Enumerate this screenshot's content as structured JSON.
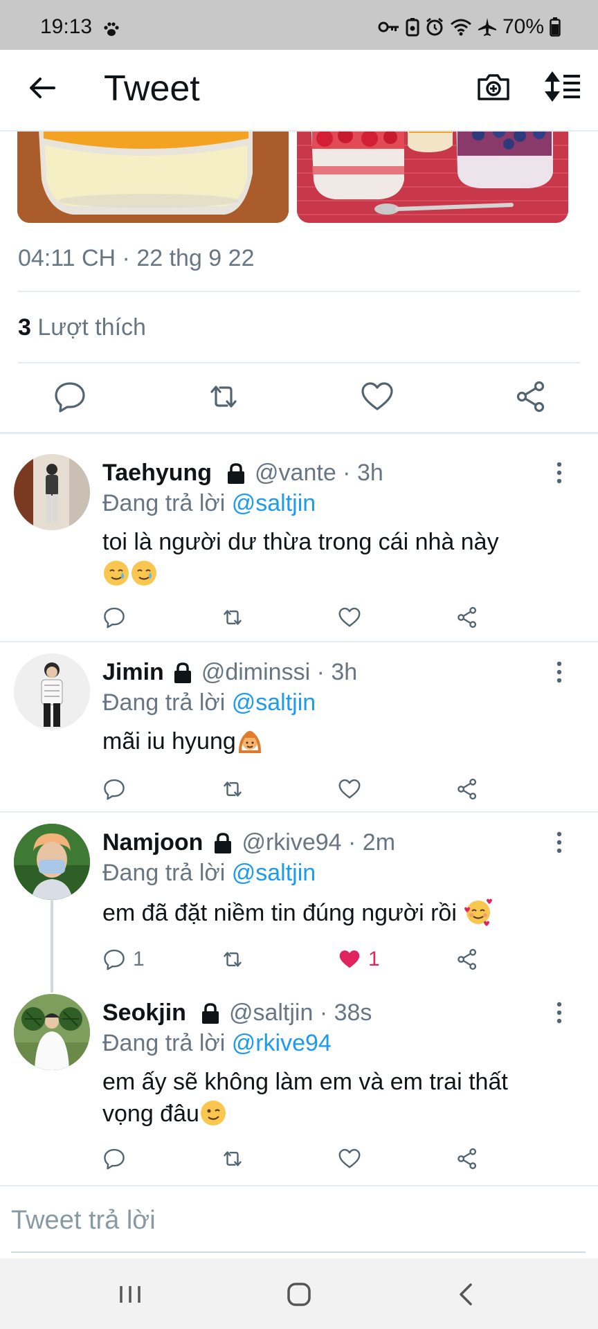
{
  "status_bar": {
    "time": "19:13",
    "battery": "70%",
    "icons": [
      "paw-icon",
      "key-icon",
      "battery-saver-icon",
      "alarm-icon",
      "wifi-icon",
      "airplane-icon",
      "battery-icon"
    ]
  },
  "header": {
    "title": "Tweet",
    "icons": [
      "back-arrow-icon",
      "camera-icon",
      "sort-icon"
    ]
  },
  "tweet": {
    "timestamp": "04:11 CH · 22 thg 9 22",
    "likes_count": "3",
    "likes_label": "Lượt thích"
  },
  "replies": [
    {
      "name": "Taehyung",
      "meta": "@vante · 3h",
      "replying_prefix": "Đang trả lời",
      "replying_to": "@saltjin",
      "text": "toi là người dư thừa trong cái nhà này",
      "emoji": [
        "smiling-face-with-tear-icon",
        "smiling-face-with-tear-icon"
      ],
      "reply_count": "",
      "like_count": "",
      "liked": false
    },
    {
      "name": "Jimin",
      "meta": "@diminssi · 3h",
      "replying_prefix": "Đang trả lời",
      "replying_to": "@saltjin",
      "text": "mãi iu hyung",
      "emoji": [
        "person-gesturing-ok-icon"
      ],
      "reply_count": "",
      "like_count": "",
      "liked": false
    },
    {
      "name": "Namjoon",
      "meta": "@rkive94 · 2m",
      "replying_prefix": "Đang trả lời",
      "replying_to": "@saltjin",
      "text": "em đã đặt niềm tin đúng người rồi",
      "emoji": [
        "smiling-face-with-hearts-icon"
      ],
      "reply_count": "1",
      "like_count": "1",
      "liked": true
    },
    {
      "name": "Seokjin",
      "meta": "@saltjin · 38s",
      "replying_prefix": "Đang trả lời",
      "replying_to": "@rkive94",
      "text_line1": "em ấy sẽ không làm em và em trai thất",
      "text_line2": "vọng đâu",
      "emoji": [
        "winking-face-icon"
      ],
      "reply_count": "",
      "like_count": "",
      "liked": false
    }
  ],
  "composer": {
    "placeholder": "Tweet trả lời"
  },
  "colors": {
    "accent": "#1d9bf0",
    "like": "#e0245e",
    "secondary_text": "#687684"
  }
}
